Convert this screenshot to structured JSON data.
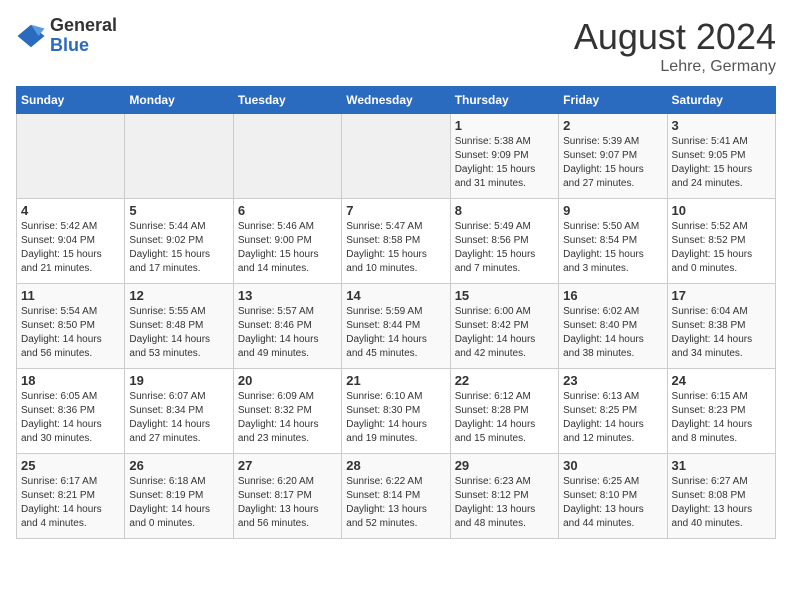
{
  "logo": {
    "general": "General",
    "blue": "Blue"
  },
  "title": "August 2024",
  "subtitle": "Lehre, Germany",
  "days_of_week": [
    "Sunday",
    "Monday",
    "Tuesday",
    "Wednesday",
    "Thursday",
    "Friday",
    "Saturday"
  ],
  "weeks": [
    [
      {
        "day": "",
        "info": ""
      },
      {
        "day": "",
        "info": ""
      },
      {
        "day": "",
        "info": ""
      },
      {
        "day": "",
        "info": ""
      },
      {
        "day": "1",
        "info": "Sunrise: 5:38 AM\nSunset: 9:09 PM\nDaylight: 15 hours\nand 31 minutes."
      },
      {
        "day": "2",
        "info": "Sunrise: 5:39 AM\nSunset: 9:07 PM\nDaylight: 15 hours\nand 27 minutes."
      },
      {
        "day": "3",
        "info": "Sunrise: 5:41 AM\nSunset: 9:05 PM\nDaylight: 15 hours\nand 24 minutes."
      }
    ],
    [
      {
        "day": "4",
        "info": "Sunrise: 5:42 AM\nSunset: 9:04 PM\nDaylight: 15 hours\nand 21 minutes."
      },
      {
        "day": "5",
        "info": "Sunrise: 5:44 AM\nSunset: 9:02 PM\nDaylight: 15 hours\nand 17 minutes."
      },
      {
        "day": "6",
        "info": "Sunrise: 5:46 AM\nSunset: 9:00 PM\nDaylight: 15 hours\nand 14 minutes."
      },
      {
        "day": "7",
        "info": "Sunrise: 5:47 AM\nSunset: 8:58 PM\nDaylight: 15 hours\nand 10 minutes."
      },
      {
        "day": "8",
        "info": "Sunrise: 5:49 AM\nSunset: 8:56 PM\nDaylight: 15 hours\nand 7 minutes."
      },
      {
        "day": "9",
        "info": "Sunrise: 5:50 AM\nSunset: 8:54 PM\nDaylight: 15 hours\nand 3 minutes."
      },
      {
        "day": "10",
        "info": "Sunrise: 5:52 AM\nSunset: 8:52 PM\nDaylight: 15 hours\nand 0 minutes."
      }
    ],
    [
      {
        "day": "11",
        "info": "Sunrise: 5:54 AM\nSunset: 8:50 PM\nDaylight: 14 hours\nand 56 minutes."
      },
      {
        "day": "12",
        "info": "Sunrise: 5:55 AM\nSunset: 8:48 PM\nDaylight: 14 hours\nand 53 minutes."
      },
      {
        "day": "13",
        "info": "Sunrise: 5:57 AM\nSunset: 8:46 PM\nDaylight: 14 hours\nand 49 minutes."
      },
      {
        "day": "14",
        "info": "Sunrise: 5:59 AM\nSunset: 8:44 PM\nDaylight: 14 hours\nand 45 minutes."
      },
      {
        "day": "15",
        "info": "Sunrise: 6:00 AM\nSunset: 8:42 PM\nDaylight: 14 hours\nand 42 minutes."
      },
      {
        "day": "16",
        "info": "Sunrise: 6:02 AM\nSunset: 8:40 PM\nDaylight: 14 hours\nand 38 minutes."
      },
      {
        "day": "17",
        "info": "Sunrise: 6:04 AM\nSunset: 8:38 PM\nDaylight: 14 hours\nand 34 minutes."
      }
    ],
    [
      {
        "day": "18",
        "info": "Sunrise: 6:05 AM\nSunset: 8:36 PM\nDaylight: 14 hours\nand 30 minutes."
      },
      {
        "day": "19",
        "info": "Sunrise: 6:07 AM\nSunset: 8:34 PM\nDaylight: 14 hours\nand 27 minutes."
      },
      {
        "day": "20",
        "info": "Sunrise: 6:09 AM\nSunset: 8:32 PM\nDaylight: 14 hours\nand 23 minutes."
      },
      {
        "day": "21",
        "info": "Sunrise: 6:10 AM\nSunset: 8:30 PM\nDaylight: 14 hours\nand 19 minutes."
      },
      {
        "day": "22",
        "info": "Sunrise: 6:12 AM\nSunset: 8:28 PM\nDaylight: 14 hours\nand 15 minutes."
      },
      {
        "day": "23",
        "info": "Sunrise: 6:13 AM\nSunset: 8:25 PM\nDaylight: 14 hours\nand 12 minutes."
      },
      {
        "day": "24",
        "info": "Sunrise: 6:15 AM\nSunset: 8:23 PM\nDaylight: 14 hours\nand 8 minutes."
      }
    ],
    [
      {
        "day": "25",
        "info": "Sunrise: 6:17 AM\nSunset: 8:21 PM\nDaylight: 14 hours\nand 4 minutes."
      },
      {
        "day": "26",
        "info": "Sunrise: 6:18 AM\nSunset: 8:19 PM\nDaylight: 14 hours\nand 0 minutes."
      },
      {
        "day": "27",
        "info": "Sunrise: 6:20 AM\nSunset: 8:17 PM\nDaylight: 13 hours\nand 56 minutes."
      },
      {
        "day": "28",
        "info": "Sunrise: 6:22 AM\nSunset: 8:14 PM\nDaylight: 13 hours\nand 52 minutes."
      },
      {
        "day": "29",
        "info": "Sunrise: 6:23 AM\nSunset: 8:12 PM\nDaylight: 13 hours\nand 48 minutes."
      },
      {
        "day": "30",
        "info": "Sunrise: 6:25 AM\nSunset: 8:10 PM\nDaylight: 13 hours\nand 44 minutes."
      },
      {
        "day": "31",
        "info": "Sunrise: 6:27 AM\nSunset: 8:08 PM\nDaylight: 13 hours\nand 40 minutes."
      }
    ]
  ]
}
